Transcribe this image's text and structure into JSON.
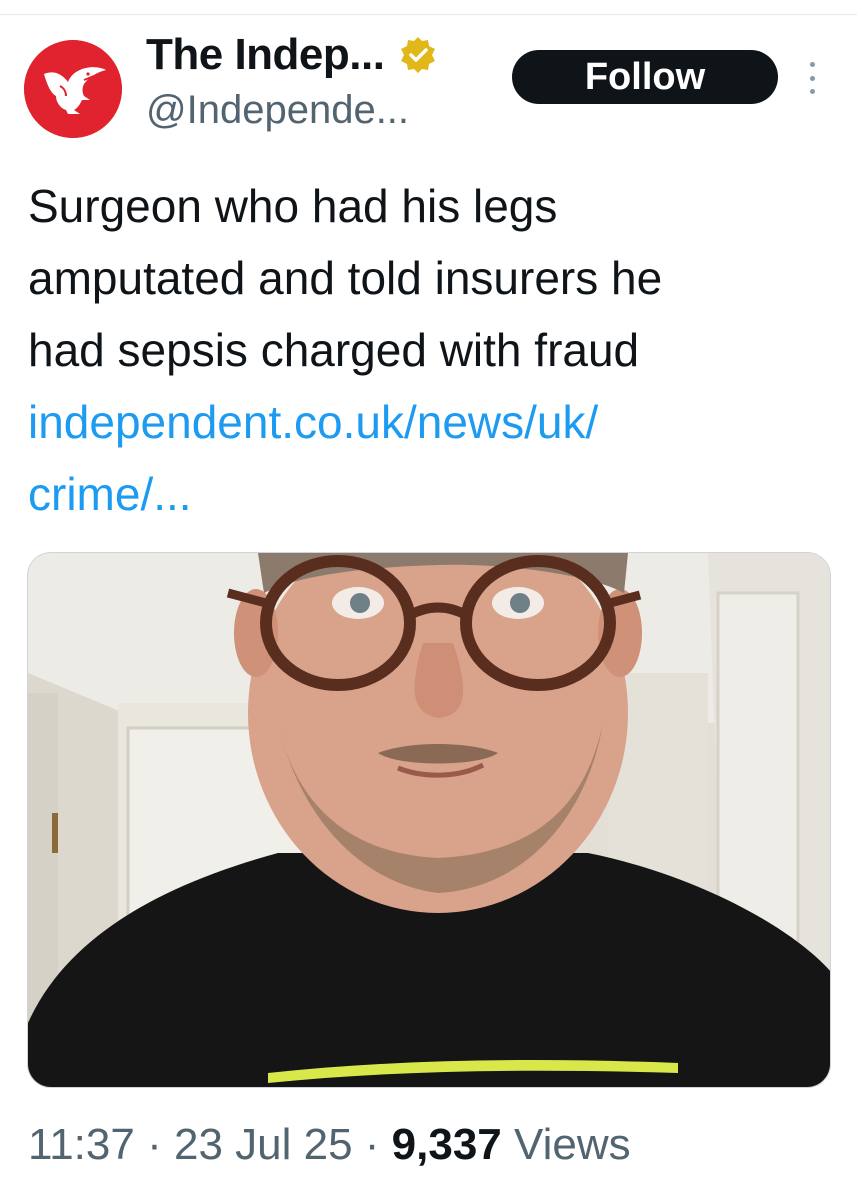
{
  "tweet": {
    "display_name": "The Indep...",
    "handle": "@Independe...",
    "follow_label": "Follow",
    "text_lines": [
      "Surgeon who had his legs",
      "amputated and told insurers he",
      "had sepsis charged with fraud"
    ],
    "link_lines": [
      "independent.co.uk/news/uk/",
      "crime/..."
    ],
    "time": "11:37",
    "separator": "·",
    "date": "23 Jul 25",
    "views_count": "9,337",
    "views_label": "Views"
  },
  "icons": {
    "avatar": "eagle-logo-icon",
    "verified": "verified-badge-icon",
    "more": "more-vertical-icon"
  },
  "colors": {
    "accent_link": "#1d9bf0",
    "avatar_red": "#e0232e",
    "verified_gold": "#e2b719",
    "follow_bg": "#0f1419",
    "meta_gray": "#536471"
  }
}
